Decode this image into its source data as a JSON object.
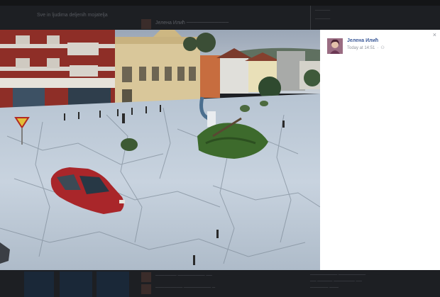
{
  "background": {
    "feed_header_text": "Sve in ljudima deljenih mojatelja",
    "top_name_text": "Јелена Илић   ────────────",
    "sidebar_lines": [
      "─────",
      "─────"
    ],
    "bottom_lines": [
      "─────── ───────── ──",
      "───────── ───────── ─"
    ],
    "bottom_right_lines": [
      "───────── ─────────",
      "── ───── ─────── ──",
      "────── ───"
    ]
  },
  "lightbox": {
    "photo_alt": "flood-hail-street-photo",
    "author": {
      "name": "Јелена Илић",
      "timestamp": "Today at 14:51",
      "clock_icon": "clock-icon",
      "audience_icon": "friends-icon"
    },
    "close_icon": "close-icon",
    "close_label": "×"
  }
}
